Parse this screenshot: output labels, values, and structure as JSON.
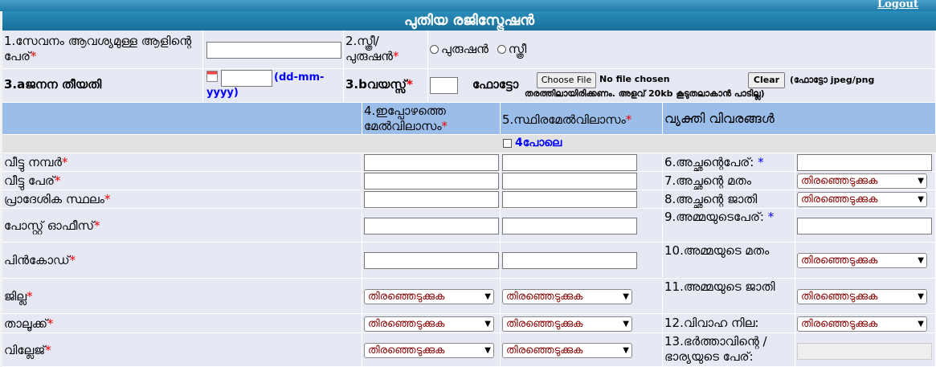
{
  "header": {
    "logout": "Logout",
    "title": "പുതിയ രജിസ്ട്രേഷൻ"
  },
  "row1": {
    "name_label": "1.സേവനം ആവശ്യമുള്ള ആളിന്റെ പേര്",
    "gender_label": "2.സ്ത്രീ/ പുരുഷൻ",
    "gender_options": [
      "പുരുഷൻ",
      "സ്ത്രീ"
    ]
  },
  "row2": {
    "dob_label": "3.aജനന തീയതി",
    "dob_hint": "(dd-mm-yyyy)",
    "age_label": "3.bവയസ്സ്",
    "photo_label": "ഫോട്ടോ",
    "choose_file": "Choose File",
    "no_file": "No file chosen",
    "clear": "Clear",
    "photo_note": "(ഫോട്ടോ jpeg/png തരത്തിലായിരിക്കണം. അളവ് 20kb കൂടുതലാകാൻ പാടില്ല)"
  },
  "columns": {
    "present_address": "4.ഇപ്പോഴത്തെ മേൽവിലാസം",
    "permanent_address": "5.സ്ഥിരമേൽവിലാസം",
    "personal_details": "വ്യക്തി വിവരങ്ങൾ",
    "same_as_4": "4പോലെ"
  },
  "address_fields": [
    "വീട്ടു നമ്പർ",
    "വീട്ടു പേര്",
    "പ്രാദേശിക സ്ഥലം",
    "പോസ്റ്റ് ഓഫീസ്",
    "പിൻകോഡ്",
    "ജില്ല",
    "താലൂക്ക്",
    "വില്ലേജ്"
  ],
  "personal_fields": {
    "father_name": "6.അച്ഛന്റെപേര്:",
    "father_religion": "7.അച്ഛന്റെ മതം",
    "father_caste": "8.അച്ഛന്റെ ജാതി",
    "mother_name": "9.അമ്മയുടെപേര്:",
    "mother_religion": "10.അമ്മയുടെ മതം",
    "mother_caste": "11.അമ്മയുടെ ജാതി",
    "marital_status": "12.വിവാഹ നില:",
    "spouse_name": "13.ഭർത്താവിന്റെ / ഭാര്യയുടെ പേര്:"
  },
  "select_placeholder": "തിരഞ്ഞെടുക്കുക",
  "required_mark": "*"
}
